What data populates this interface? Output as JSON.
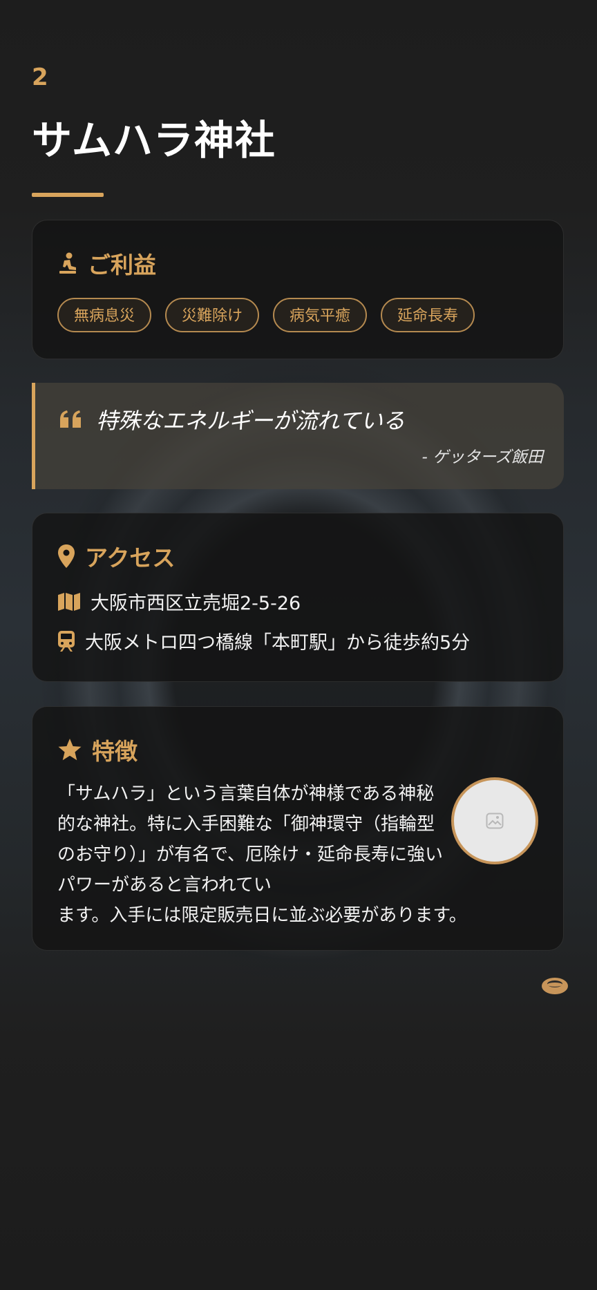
{
  "shrine": {
    "number": "2",
    "name": "サムハラ神社"
  },
  "benefits": {
    "heading": "ご利益",
    "icon": "praying-person-icon",
    "tags": [
      "無病息災",
      "災難除け",
      "病気平癒",
      "延命長寿"
    ]
  },
  "quote": {
    "icon": "quote-icon",
    "text": "特殊なエネルギーが流れている",
    "author": "- ゲッターズ飯田"
  },
  "access": {
    "heading": "アクセス",
    "icon": "map-pin-icon",
    "address_icon": "map-icon",
    "address": "大阪市西区立売堀2-5-26",
    "transit_icon": "train-icon",
    "transit": "大阪メトロ四つ橋線「本町駅」から徒歩約5分"
  },
  "features": {
    "heading": "特徴",
    "icon": "star-icon",
    "text": "「サムハラ」という言葉自体が神様である神秘的な神社。特に入手困難な「御神環守（指輪型のお守り）」が有名で、厄除け・延命長寿に強いパワーがあると言われてい",
    "text_tail": "ます。入手には限定販売日に並ぶ必要があります。",
    "image_icon": "image-placeholder-icon"
  },
  "decor": {
    "ring_icon": "ring-icon"
  },
  "colors": {
    "accent": "#d8a45c",
    "background": "#1b1b1b",
    "card": "#141414",
    "text": "#f2f2f2"
  }
}
